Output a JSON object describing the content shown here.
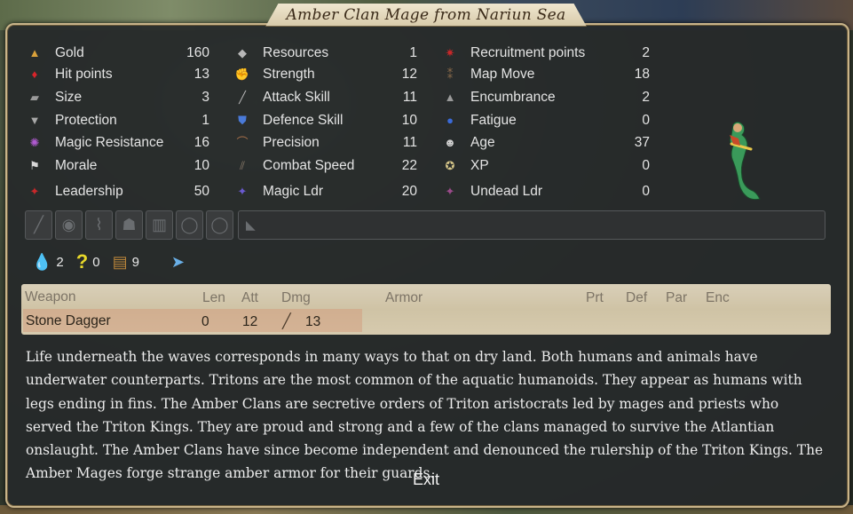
{
  "title": "Amber Clan Mage from Nariun Sea",
  "stats_col1": [
    {
      "icon": "gold-icon",
      "label": "Gold",
      "value": "160"
    },
    {
      "icon": "heart-icon",
      "label": "Hit points",
      "value": "13"
    },
    {
      "icon": "size-icon",
      "label": "Size",
      "value": "3"
    },
    {
      "icon": "armor-icon",
      "label": "Protection",
      "value": "1"
    },
    {
      "icon": "magic-resistance-icon",
      "label": "Magic Resistance",
      "value": "16"
    },
    {
      "icon": "flag-icon",
      "label": "Morale",
      "value": "10"
    },
    {
      "icon": "leadership-icon",
      "label": "Leadership",
      "value": "50"
    }
  ],
  "stats_col2": [
    {
      "icon": "resources-icon",
      "label": "Resources",
      "value": "1"
    },
    {
      "icon": "strength-arm-icon",
      "label": "Strength",
      "value": "12"
    },
    {
      "icon": "sword-icon",
      "label": "Attack Skill",
      "value": "11"
    },
    {
      "icon": "shield-icon",
      "label": "Defence Skill",
      "value": "10"
    },
    {
      "icon": "bow-icon",
      "label": "Precision",
      "value": "11"
    },
    {
      "icon": "boots-icon",
      "label": "Combat Speed",
      "value": "22"
    },
    {
      "icon": "magic-leader-icon",
      "label": "Magic Ldr",
      "value": "20"
    }
  ],
  "stats_col3": [
    {
      "icon": "recruitment-icon",
      "label": "Recruitment points",
      "value": "2"
    },
    {
      "icon": "footprints-icon",
      "label": "Map Move",
      "value": "18"
    },
    {
      "icon": "weight-icon",
      "label": "Encumbrance",
      "value": "2"
    },
    {
      "icon": "drop-icon",
      "label": "Fatigue",
      "value": "0"
    },
    {
      "icon": "skull-icon",
      "label": "Age",
      "value": "37"
    },
    {
      "icon": "star-icon",
      "label": "XP",
      "value": "0"
    },
    {
      "icon": "undead-leader-icon",
      "label": "Undead Ldr",
      "value": "0"
    }
  ],
  "gems": [
    {
      "icon": "water-gem-icon",
      "value": "2"
    },
    {
      "icon": "question-icon",
      "value": "0"
    },
    {
      "icon": "chest-icon",
      "value": "9"
    }
  ],
  "weapon_table": {
    "headers": {
      "weapon": "Weapon",
      "len": "Len",
      "att": "Att",
      "dmg": "Dmg",
      "armor": "Armor",
      "prt": "Prt",
      "def": "Def",
      "par": "Par",
      "enc": "Enc"
    },
    "rows": [
      {
        "weapon": "Stone Dagger",
        "len": "0",
        "att": "12",
        "dmg": "13"
      }
    ]
  },
  "description": "Life underneath the waves corresponds in many ways to that on dry land. Both humans and animals have underwater counterparts. Tritons are the most common of the aquatic humanoids. They appear as humans with legs ending in fins. The Amber Clans are secretive orders of Triton aristocrats led by mages and priests who served the Triton Kings. They are proud and strong and a few of the clans managed to survive the Atlantian onslaught. The Amber Clans have since become independent and denounced the rulership of the Triton Kings. The Amber Mages forge strange amber armor for their guards.",
  "exit_label": "Exit",
  "colors": {
    "panel_border": "#c9b48a",
    "banner": "#efe6cf",
    "table_bg": "#d9cfb8",
    "highlight": "#d2967a"
  }
}
